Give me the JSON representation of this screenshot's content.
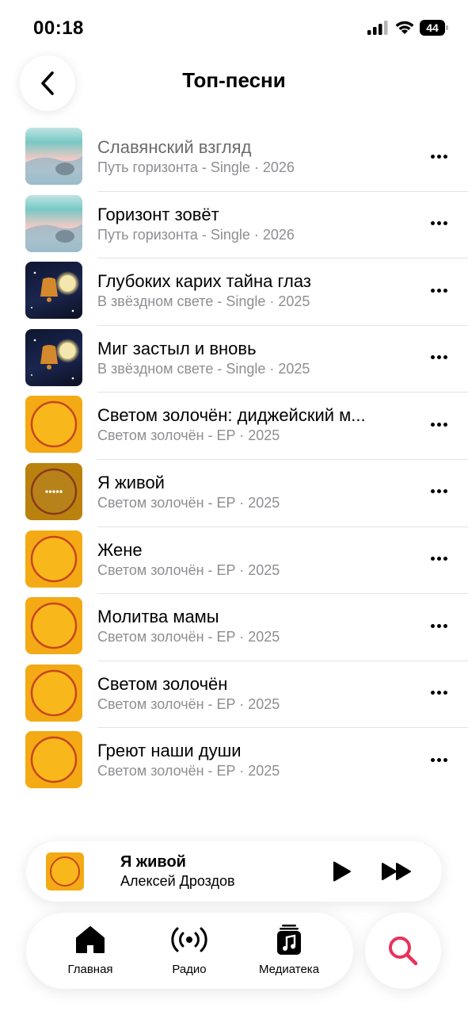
{
  "status_bar": {
    "time": "00:18",
    "battery": "44"
  },
  "header": {
    "title": "Топ-песни"
  },
  "songs": [
    {
      "title": "Славянский взгляд",
      "subtitle": "Путь горизонта - Single · 2026",
      "art": "horizon"
    },
    {
      "title": "Горизонт зовёт",
      "subtitle": "Путь горизонта - Single · 2026",
      "art": "horizon"
    },
    {
      "title": "Глубоких карих тайна глаз",
      "subtitle": "В звёздном свете - Single · 2025",
      "art": "star"
    },
    {
      "title": "Миг застыл и вновь",
      "subtitle": "В звёздном свете - Single · 2025",
      "art": "star"
    },
    {
      "title": "Светом золочён: диджейский м...",
      "subtitle": "Светом золочён - EP · 2025",
      "art": "sun"
    },
    {
      "title": "Я живой",
      "subtitle": "Светом золочён - EP · 2025",
      "art": "sun-playing"
    },
    {
      "title": "Жене",
      "subtitle": "Светом золочён - EP · 2025",
      "art": "sun"
    },
    {
      "title": "Молитва мамы",
      "subtitle": "Светом золочён - EP · 2025",
      "art": "sun"
    },
    {
      "title": "Светом золочён",
      "subtitle": "Светом золочён - EP · 2025",
      "art": "sun"
    },
    {
      "title": "Греют наши души",
      "subtitle": "Светом золочён - EP · 2025",
      "art": "sun"
    }
  ],
  "mini_player": {
    "title": "Я живой",
    "artist": "Алексей Дроздов"
  },
  "tabs": [
    {
      "label": "Главная",
      "icon": "home-icon"
    },
    {
      "label": "Радио",
      "icon": "radio-icon"
    },
    {
      "label": "Медиатека",
      "icon": "library-icon"
    }
  ],
  "colors": {
    "accent": "#e8325a",
    "secondary_text": "#8e8e93",
    "sun_art": "#f3aa14"
  }
}
